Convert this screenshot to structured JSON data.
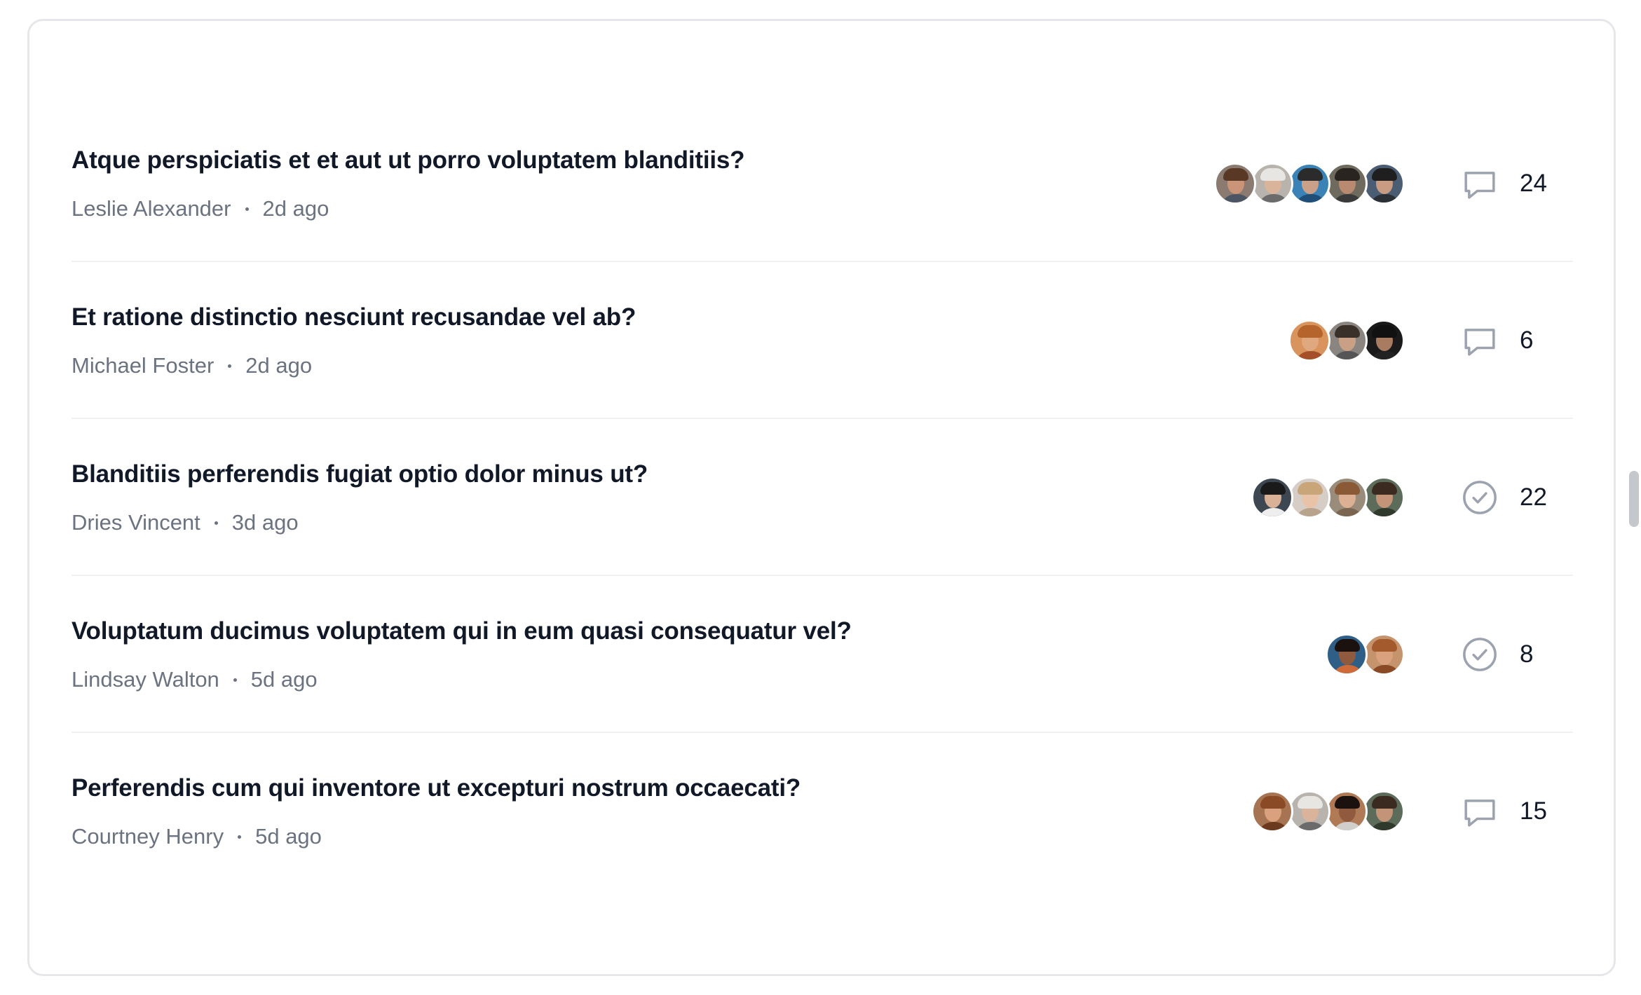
{
  "threads": [
    {
      "title": "Atque perspiciatis et et aut ut porro voluptatem blanditiis?",
      "author": "Leslie Alexander",
      "time": "2d ago",
      "status_icon": "comment-icon",
      "count": "24",
      "avatars": [
        {
          "skin": "#c99478",
          "hair": "#5a3826",
          "bg": "#8a7a70",
          "shirt": "#4b5563"
        },
        {
          "skin": "#d9b49a",
          "hair": "#e8e6e2",
          "bg": "#b8b3ad",
          "shirt": "#6b6b6b"
        },
        {
          "skin": "#caa088",
          "hair": "#2b2b2b",
          "bg": "#3b82b6",
          "shirt": "#1f4e79"
        },
        {
          "skin": "#b98a6f",
          "hair": "#2a2420",
          "bg": "#6f6a5e",
          "shirt": "#3a3a3a"
        },
        {
          "skin": "#c79c82",
          "hair": "#1f1f1f",
          "bg": "#4b5d73",
          "shirt": "#2b2f36"
        }
      ]
    },
    {
      "title": "Et ratione distinctio nesciunt recusandae vel ab?",
      "author": "Michael Foster",
      "time": "2d ago",
      "status_icon": "comment-icon",
      "count": "6",
      "avatars": [
        {
          "skin": "#e0a87f",
          "hair": "#b5652c",
          "bg": "#d9945e",
          "shirt": "#a44f2a"
        },
        {
          "skin": "#c9a085",
          "hair": "#3a302a",
          "bg": "#8a8580",
          "shirt": "#555"
        },
        {
          "skin": "#a97c62",
          "hair": "#111",
          "bg": "#1a1a1a",
          "shirt": "#222"
        }
      ]
    },
    {
      "title": "Blanditiis perferendis fugiat optio dolor minus ut?",
      "author": "Dries Vincent",
      "time": "3d ago",
      "status_icon": "check-circle-icon",
      "count": "22",
      "avatars": [
        {
          "skin": "#d9b196",
          "hair": "#1a1a1a",
          "bg": "#3d4752",
          "shirt": "#eeeeee"
        },
        {
          "skin": "#e8c3a8",
          "hair": "#c9a57a",
          "bg": "#d6cec6",
          "shirt": "#b8a48c"
        },
        {
          "skin": "#dcb092",
          "hair": "#8a5a36",
          "bg": "#9a8c7a",
          "shirt": "#7a6650"
        },
        {
          "skin": "#c49478",
          "hair": "#3a2a20",
          "bg": "#5d6b5a",
          "shirt": "#2f3a2c"
        }
      ]
    },
    {
      "title": "Voluptatum ducimus voluptatem qui in eum quasi consequatur vel?",
      "author": "Lindsay Walton",
      "time": "5d ago",
      "status_icon": "check-circle-icon",
      "count": "8",
      "avatars": [
        {
          "skin": "#8f5a3e",
          "hair": "#1b1210",
          "bg": "#2f5f86",
          "shirt": "#cf6b3a"
        },
        {
          "skin": "#d9a17e",
          "hair": "#a35a2c",
          "bg": "#c6946c",
          "shirt": "#8a4a26"
        }
      ]
    },
    {
      "title": "Perferendis cum qui inventore ut excepturi nostrum occaecati?",
      "author": "Courtney Henry",
      "time": "5d ago",
      "status_icon": "comment-icon",
      "count": "15",
      "avatars": [
        {
          "skin": "#d9a17e",
          "hair": "#8a4a26",
          "bg": "#a67452",
          "shirt": "#6b3a1e"
        },
        {
          "skin": "#d9b49a",
          "hair": "#e8e6e2",
          "bg": "#b8b3ad",
          "shirt": "#6b6b6b"
        },
        {
          "skin": "#8f5a3e",
          "hair": "#1b1210",
          "bg": "#b07a56",
          "shirt": "#d0cfcc"
        },
        {
          "skin": "#c49478",
          "hair": "#3a2a20",
          "bg": "#5d6b5a",
          "shirt": "#2f3a2c"
        }
      ]
    }
  ]
}
